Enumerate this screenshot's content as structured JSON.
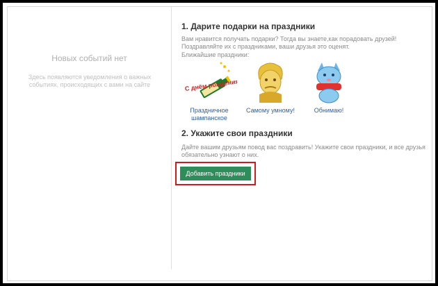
{
  "left_panel": {
    "title": "Новых событий нет",
    "description": "Здесь появляются уведомления о важных событиях, происходящих с вами на сайте"
  },
  "section1": {
    "title": "1. Дарите подарки на праздники",
    "text": "Вам нравится получать подарки? Тогда вы знаете,как порадовать друзей! Поздравляйте их с праздниками, ваши друзья это оценят.",
    "subtitle": "Ближайшие праздники:"
  },
  "gifts": [
    {
      "label": "Праздничное шампанское",
      "icon": "champagne-icon",
      "image_text": "С днём рождения!"
    },
    {
      "label": "Самому умному!",
      "icon": "einstein-icon"
    },
    {
      "label": "Обнимаю!",
      "icon": "blue-cat-icon"
    }
  ],
  "section2": {
    "title": "2. Укажите свои праздники",
    "text": "Дайте вашим друзьям повод вас поздравить! Укажите свои праздники, и все друзья обязательно узнают о них."
  },
  "add_button": {
    "label": "Добавить праздники"
  },
  "colors": {
    "accent": "#2f8d5b",
    "highlight": "#d11b1b",
    "link": "#2f5fa5"
  }
}
